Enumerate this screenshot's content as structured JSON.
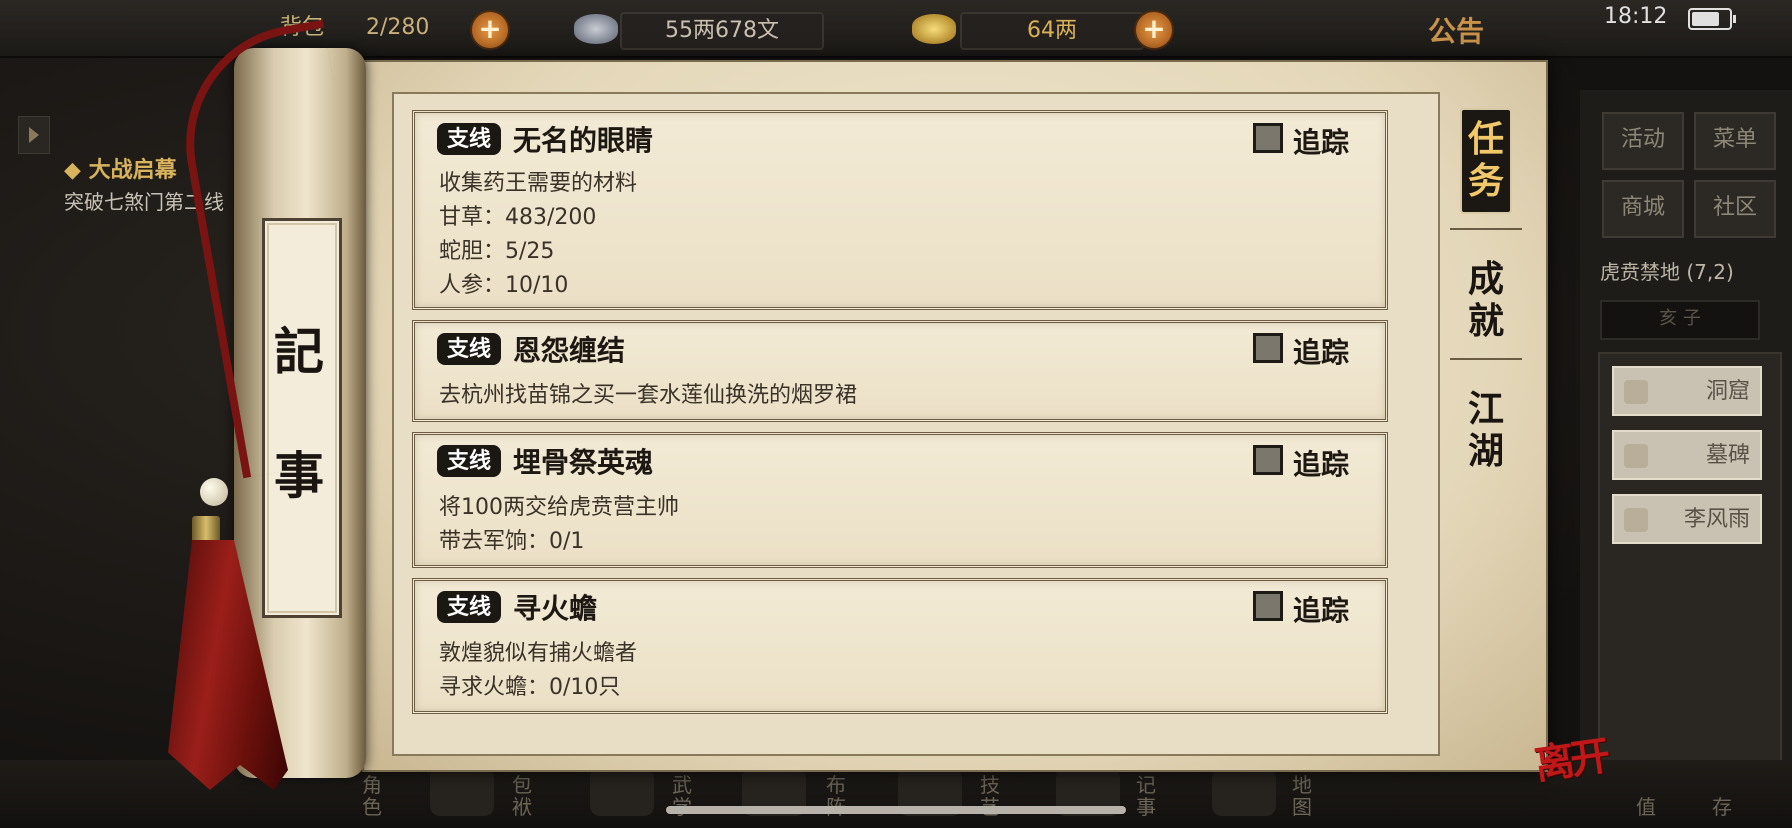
{
  "status_bar": {
    "time": "18:12",
    "battery_level": 0.75
  },
  "top_bar": {
    "backpack_label": "背包",
    "backpack_count": "2/280",
    "silver": "55两678文",
    "gold": "64两",
    "announcement": "公告"
  },
  "left_quest": {
    "title": "◆ 大战启幕",
    "description": "突破七煞门第二线"
  },
  "scroll": {
    "label_chars": [
      "記",
      "事"
    ]
  },
  "tabs": [
    {
      "label": "任务",
      "active": true
    },
    {
      "label": "成就",
      "active": false
    },
    {
      "label": "江湖",
      "active": false
    }
  ],
  "quests": [
    {
      "tag": "支线",
      "title": "无名的眼睛",
      "track_label": "追踪",
      "lines": [
        "收集药王需要的材料",
        "甘草：483/200",
        "蛇胆：5/25",
        "人参：10/10"
      ]
    },
    {
      "tag": "支线",
      "title": "恩怨缠结",
      "track_label": "追踪",
      "lines": [
        "去杭州找苗锦之买一套水莲仙换洗的烟罗裙"
      ]
    },
    {
      "tag": "支线",
      "title": "埋骨祭英魂",
      "track_label": "追踪",
      "lines": [
        "将100两交给虎贲营主帅",
        "带去军饷：0/1"
      ]
    },
    {
      "tag": "支线",
      "title": "寻火蟾",
      "track_label": "追踪",
      "lines": [
        "敦煌貌似有捕火蟾者",
        "寻求火蟾：0/10只"
      ]
    }
  ],
  "right_panel": {
    "buttons": [
      "活动",
      "菜单",
      "商城",
      "社区"
    ],
    "location": "虎贲禁地 (7,2)",
    "compass": "亥 子",
    "list_items": [
      "洞窟",
      "墓碑",
      "李风雨"
    ]
  },
  "bottom_bar": {
    "items": [
      "角色",
      "包袱",
      "武学",
      "布阵",
      "技艺",
      "记事",
      "地图"
    ],
    "right_items": [
      "值",
      "存"
    ],
    "leave_label": "离开"
  }
}
